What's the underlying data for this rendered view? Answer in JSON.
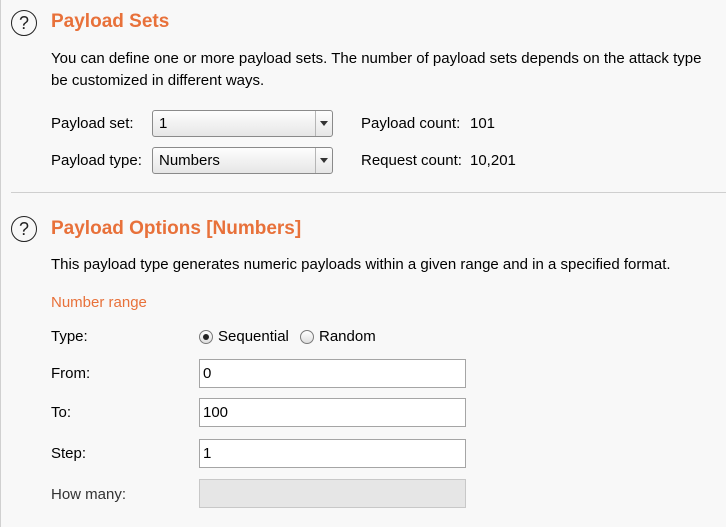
{
  "payload_sets": {
    "title": "Payload Sets",
    "description_line1": "You can define one or more payload sets. The number of payload sets depends on the attack type",
    "description_line2": "be customized in different ways.",
    "payload_set_label": "Payload set:",
    "payload_set_value": "1",
    "payload_type_label": "Payload type:",
    "payload_type_value": "Numbers",
    "payload_count_label": "Payload count:",
    "payload_count_value": "101",
    "request_count_label": "Request count:",
    "request_count_value": "10,201"
  },
  "payload_options": {
    "title": "Payload Options [Numbers]",
    "description": "This payload type generates numeric payloads within a given range and in a specified format.",
    "number_range_heading": "Number range",
    "type_label": "Type:",
    "type_options": [
      "Sequential",
      "Random"
    ],
    "type_selected": "Sequential",
    "from_label": "From:",
    "from_value": "0",
    "to_label": "To:",
    "to_value": "100",
    "step_label": "Step:",
    "step_value": "1",
    "how_many_label": "How many:",
    "how_many_value": ""
  },
  "icons": {
    "help": "?"
  },
  "colors": {
    "accent": "#e8713a",
    "background": "#f8f8f8"
  }
}
